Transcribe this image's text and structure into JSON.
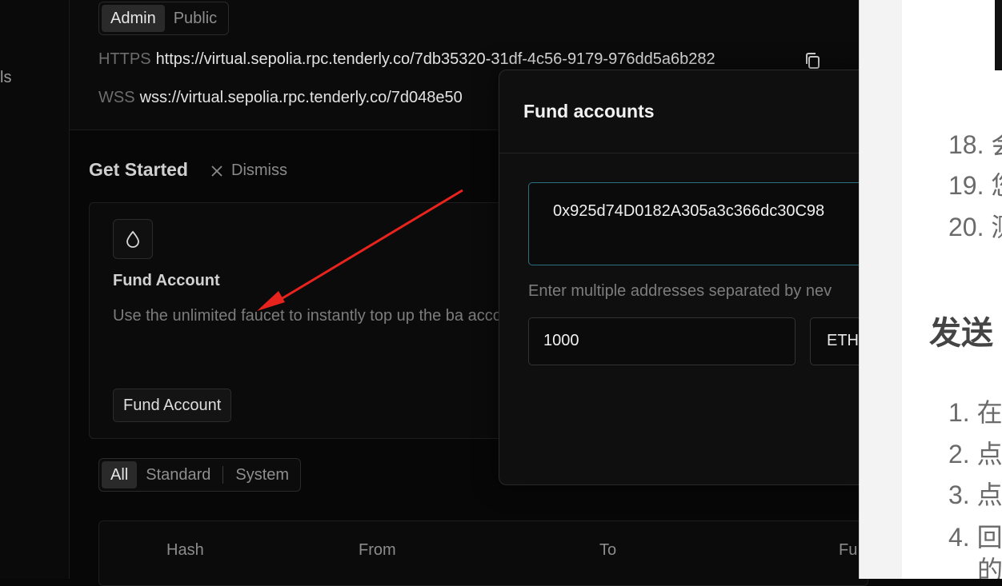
{
  "sidebar": {
    "partial_label": "ls"
  },
  "access_tabs": {
    "items": [
      "Admin",
      "Public"
    ],
    "active": "Admin"
  },
  "rpc": {
    "https_label": "HTTPS",
    "https_url": "https://virtual.sepolia.rpc.tenderly.co/7db35320-31df-4c56-9179-976dd5a6b282",
    "wss_label": "WSS",
    "wss_url": "wss://virtual.sepolia.rpc.tenderly.co/7d048e50"
  },
  "get_started": {
    "title": "Get Started",
    "dismiss_label": "Dismiss",
    "card": {
      "title": "Fund Account",
      "description": "Use the unlimited faucet to instantly top up the ba account.",
      "button_label": "Fund Account"
    }
  },
  "tx_filter": {
    "items": [
      "All",
      "Standard",
      "System"
    ],
    "active": "All"
  },
  "tx_table": {
    "columns": [
      "Hash",
      "From",
      "To",
      "Fu"
    ]
  },
  "modal": {
    "title": "Fund accounts",
    "address_value": "0x925d74D0182A305a3c366dc30C98",
    "helper_text": "Enter multiple addresses separated by nev",
    "amount_value": "1000",
    "currency_value": "ETH"
  },
  "doc": {
    "list_top": [
      "18. 会",
      "19. 您",
      "20. 测"
    ],
    "heading": "发送",
    "list_bottom": [
      "1. 在",
      "2. 点",
      "3. 点",
      "4. 回",
      "的"
    ]
  },
  "colors": {
    "accent_border": "#2b6f83",
    "annotation_arrow": "#e8231e"
  }
}
